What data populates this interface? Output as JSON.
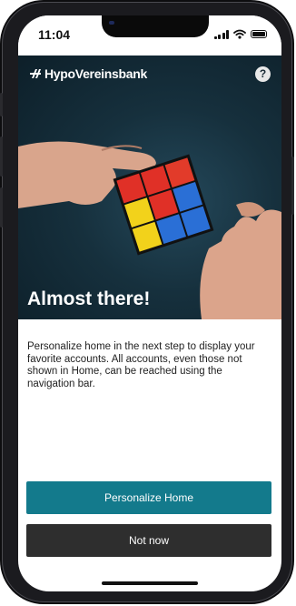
{
  "status_bar": {
    "time": "11:04"
  },
  "header": {
    "brand_name": "HypoVereinsbank",
    "help_glyph": "?"
  },
  "hero": {
    "title": "Almost there!"
  },
  "main": {
    "description": "Personalize home in the next step to display your favorite accounts. All accounts, even those not shown in Home, can be reached using the navigation bar."
  },
  "actions": {
    "primary_label": "Personalize Home",
    "secondary_label": "Not now"
  },
  "colors": {
    "primary_button": "#137a8c",
    "secondary_button": "#2e2e2e",
    "hero_background": "#16303d"
  },
  "icons": [
    "signal-icon",
    "wifi-icon",
    "battery-icon",
    "hvb-logo-icon",
    "help-icon"
  ]
}
